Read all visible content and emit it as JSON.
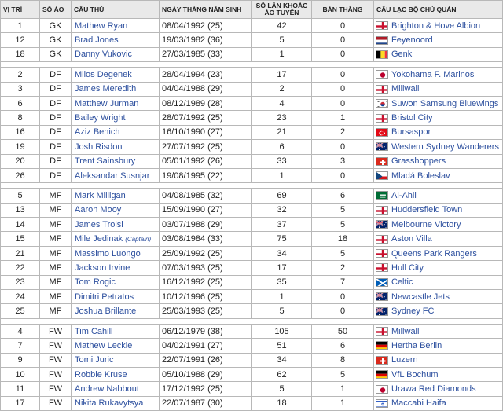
{
  "headers": {
    "pos": "VỊ TRÍ",
    "shirt": "SỐ ÁO",
    "player": "CẦU THỦ",
    "dob": "NGÀY THÁNG NĂM SINH",
    "caps": "SỐ LẦN KHOÁC ÁO TUYỂN",
    "goals": "BÀN THẮNG",
    "club": "CÂU LẠC BỘ CHỦ QUẢN"
  },
  "captain_label": "(Captain)",
  "groups": [
    {
      "rows": [
        {
          "no": "1",
          "pos": "GK",
          "name": "Mathew Ryan",
          "dob": "08/04/1992 (25)",
          "caps": "42",
          "goals": "0",
          "club": "Brighton & Hove Albion",
          "flag": "ENG"
        },
        {
          "no": "12",
          "pos": "GK",
          "name": "Brad Jones",
          "dob": "19/03/1982 (36)",
          "caps": "5",
          "goals": "0",
          "club": "Feyenoord",
          "flag": "NED"
        },
        {
          "no": "18",
          "pos": "GK",
          "name": "Danny Vukovic",
          "dob": "27/03/1985 (33)",
          "caps": "1",
          "goals": "0",
          "club": "Genk",
          "flag": "BEL"
        }
      ]
    },
    {
      "rows": [
        {
          "no": "2",
          "pos": "DF",
          "name": "Milos Degenek",
          "dob": "28/04/1994 (23)",
          "caps": "17",
          "goals": "0",
          "club": "Yokohama F. Marinos",
          "flag": "JPN"
        },
        {
          "no": "3",
          "pos": "DF",
          "name": "James Meredith",
          "dob": "04/04/1988 (29)",
          "caps": "2",
          "goals": "0",
          "club": "Millwall",
          "flag": "ENG"
        },
        {
          "no": "6",
          "pos": "DF",
          "name": "Matthew Jurman",
          "dob": "08/12/1989 (28)",
          "caps": "4",
          "goals": "0",
          "club": "Suwon Samsung Bluewings",
          "flag": "KOR"
        },
        {
          "no": "8",
          "pos": "DF",
          "name": "Bailey Wright",
          "dob": "28/07/1992 (25)",
          "caps": "23",
          "goals": "1",
          "club": "Bristol City",
          "flag": "ENG"
        },
        {
          "no": "16",
          "pos": "DF",
          "name": "Aziz Behich",
          "dob": "16/10/1990 (27)",
          "caps": "21",
          "goals": "2",
          "club": "Bursaspor",
          "flag": "TUR"
        },
        {
          "no": "19",
          "pos": "DF",
          "name": "Josh Risdon",
          "dob": "27/07/1992 (25)",
          "caps": "6",
          "goals": "0",
          "club": "Western Sydney Wanderers",
          "flag": "AUS"
        },
        {
          "no": "20",
          "pos": "DF",
          "name": "Trent Sainsbury",
          "dob": "05/01/1992 (26)",
          "caps": "33",
          "goals": "3",
          "club": "Grasshoppers",
          "flag": "SUI"
        },
        {
          "no": "26",
          "pos": "DF",
          "name": "Aleksandar Susnjar",
          "dob": "19/08/1995 (22)",
          "caps": "1",
          "goals": "0",
          "club": "Mladá Boleslav",
          "flag": "CZE"
        }
      ]
    },
    {
      "rows": [
        {
          "no": "5",
          "pos": "MF",
          "name": "Mark Milligan",
          "dob": "04/08/1985 (32)",
          "caps": "69",
          "goals": "6",
          "club": "Al-Ahli",
          "flag": "KSA"
        },
        {
          "no": "13",
          "pos": "MF",
          "name": "Aaron Mooy",
          "dob": "15/09/1990 (27)",
          "caps": "32",
          "goals": "5",
          "club": "Huddersfield Town",
          "flag": "ENG"
        },
        {
          "no": "14",
          "pos": "MF",
          "name": "James Troisi",
          "dob": "03/07/1988 (29)",
          "caps": "37",
          "goals": "5",
          "club": "Melbourne Victory",
          "flag": "AUS"
        },
        {
          "no": "15",
          "pos": "MF",
          "name": "Mile Jedinak",
          "captain": true,
          "dob": "03/08/1984 (33)",
          "caps": "75",
          "goals": "18",
          "club": "Aston Villa",
          "flag": "ENG"
        },
        {
          "no": "21",
          "pos": "MF",
          "name": "Massimo Luongo",
          "dob": "25/09/1992 (25)",
          "caps": "34",
          "goals": "5",
          "club": "Queens Park Rangers",
          "flag": "ENG"
        },
        {
          "no": "22",
          "pos": "MF",
          "name": "Jackson Irvine",
          "dob": "07/03/1993 (25)",
          "caps": "17",
          "goals": "2",
          "club": "Hull City",
          "flag": "ENG"
        },
        {
          "no": "23",
          "pos": "MF",
          "name": "Tom Rogic",
          "dob": "16/12/1992 (25)",
          "caps": "35",
          "goals": "7",
          "club": "Celtic",
          "flag": "SCO"
        },
        {
          "no": "24",
          "pos": "MF",
          "name": "Dimitri Petratos",
          "dob": "10/12/1996 (25)",
          "caps": "1",
          "goals": "0",
          "club": "Newcastle Jets",
          "flag": "AUS"
        },
        {
          "no": "25",
          "pos": "MF",
          "name": "Joshua Brillante",
          "dob": "25/03/1993 (25)",
          "caps": "5",
          "goals": "0",
          "club": "Sydney FC",
          "flag": "AUS"
        }
      ]
    },
    {
      "rows": [
        {
          "no": "4",
          "pos": "FW",
          "name": "Tim Cahill",
          "dob": "06/12/1979 (38)",
          "caps": "105",
          "goals": "50",
          "club": "Millwall",
          "flag": "ENG"
        },
        {
          "no": "7",
          "pos": "FW",
          "name": "Mathew Leckie",
          "dob": "04/02/1991 (27)",
          "caps": "51",
          "goals": "6",
          "club": "Hertha Berlin",
          "flag": "GER"
        },
        {
          "no": "9",
          "pos": "FW",
          "name": "Tomi Juric",
          "dob": "22/07/1991 (26)",
          "caps": "34",
          "goals": "8",
          "club": "Luzern",
          "flag": "SUI"
        },
        {
          "no": "10",
          "pos": "FW",
          "name": "Robbie Kruse",
          "dob": "05/10/1988 (29)",
          "caps": "62",
          "goals": "5",
          "club": "VfL Bochum",
          "flag": "GER"
        },
        {
          "no": "11",
          "pos": "FW",
          "name": "Andrew Nabbout",
          "dob": "17/12/1992 (25)",
          "caps": "5",
          "goals": "1",
          "club": "Urawa Red Diamonds",
          "flag": "JPN"
        },
        {
          "no": "17",
          "pos": "FW",
          "name": "Nikita Rukavytsya",
          "dob": "22/07/1987 (30)",
          "caps": "18",
          "goals": "1",
          "club": "Maccabi Haifa",
          "flag": "ISR"
        }
      ]
    }
  ]
}
